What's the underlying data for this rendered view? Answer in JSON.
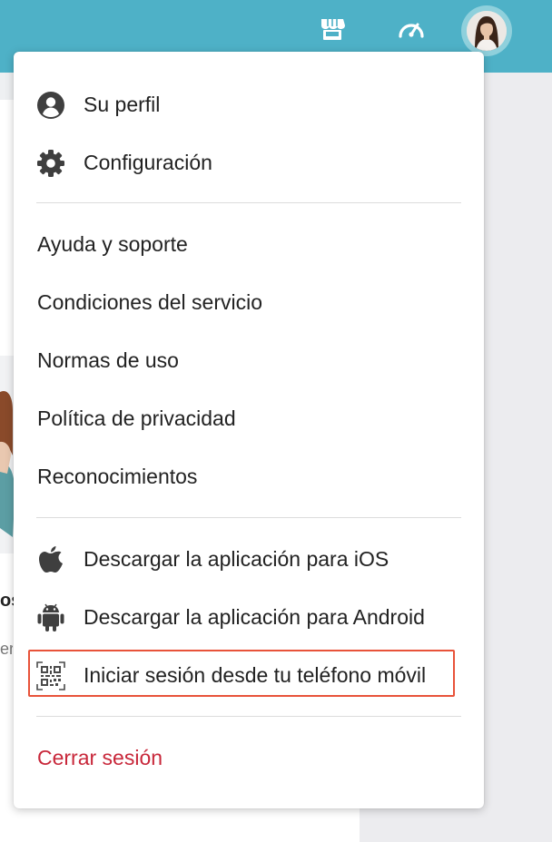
{
  "topbar": {
    "bg_color": "#4eb1c7",
    "icons": [
      "store-icon",
      "speedometer-icon"
    ],
    "avatar": "user-avatar"
  },
  "menu": {
    "account_items": [
      {
        "label": "Su perfil",
        "icon": "user-circle-icon"
      },
      {
        "label": "Configuración",
        "icon": "gear-icon"
      }
    ],
    "info_items": [
      {
        "label": "Ayuda y soporte"
      },
      {
        "label": "Condiciones del servicio"
      },
      {
        "label": "Normas de uso"
      },
      {
        "label": "Política de privacidad"
      },
      {
        "label": "Reconocimientos"
      }
    ],
    "app_items": [
      {
        "label": "Descargar la aplicación para iOS",
        "icon": "apple-icon"
      },
      {
        "label": "Descargar la aplicación para Android",
        "icon": "android-icon"
      },
      {
        "label": "Iniciar sesión desde tu teléfono móvil",
        "icon": "qr-code-icon",
        "highlighted": true
      }
    ],
    "logout_label": "Cerrar sesión",
    "logout_color": "#c8273a",
    "highlight_color": "#e8533a"
  },
  "background": {
    "partial_heading": "os",
    "partial_text": "ers"
  }
}
